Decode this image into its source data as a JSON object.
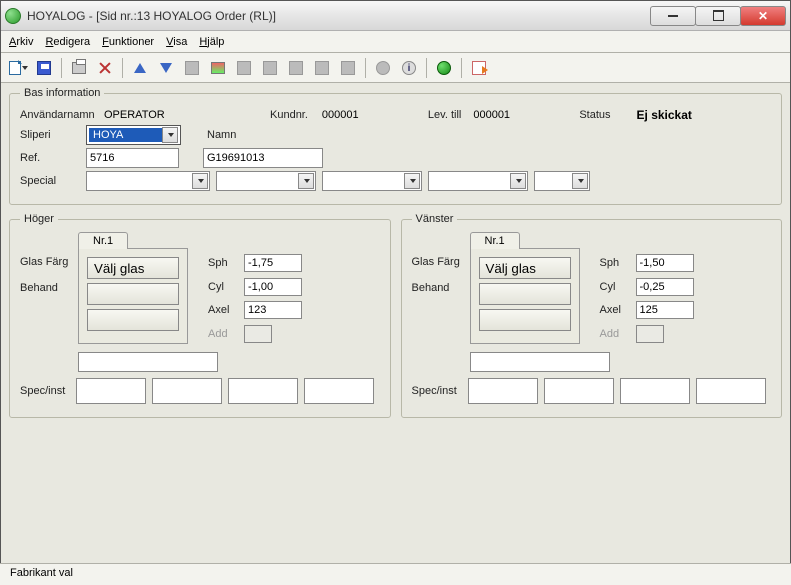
{
  "title": "HOYALOG - [Sid nr.:13 HOYALOG Order (RL)]",
  "menus": {
    "arkiv": "Arkiv",
    "redigera": "Redigera",
    "funktioner": "Funktioner",
    "visa": "Visa",
    "hjalp": "Hjälp"
  },
  "bas": {
    "legend": "Bas information",
    "anvandarnamn_lbl": "Användarnamn",
    "anvandarnamn": "OPERATOR",
    "kundnr_lbl": "Kundnr.",
    "kundnr": "000001",
    "levtill_lbl": "Lev. till",
    "levtill": "000001",
    "status_lbl": "Status",
    "status": "Ej skickat",
    "sliperi_lbl": "Sliperi",
    "sliperi": "HOYA",
    "ref_lbl": "Ref.",
    "ref": "5716",
    "namn_lbl": "Namn",
    "namn": "G19691013",
    "special_lbl": "Special"
  },
  "hoger": {
    "legend": "Höger",
    "tab": "Nr.1",
    "glas_lbl": "Glas",
    "glas_btn": "Välj glas",
    "farg_lbl": "Färg",
    "behand_lbl": "Behand",
    "spec_lbl": "Spec/inst",
    "sph_lbl": "Sph",
    "sph": "-1,75",
    "cyl_lbl": "Cyl",
    "cyl": "-1,00",
    "axel_lbl": "Axel",
    "axel": "123",
    "add_lbl": "Add",
    "add": ""
  },
  "vanster": {
    "legend": "Vänster",
    "tab": "Nr.1",
    "glas_lbl": "Glas",
    "glas_btn": "Välj glas",
    "farg_lbl": "Färg",
    "behand_lbl": "Behand",
    "spec_lbl": "Spec/inst",
    "sph_lbl": "Sph",
    "sph": "-1,50",
    "cyl_lbl": "Cyl",
    "cyl": "-0,25",
    "axel_lbl": "Axel",
    "axel": "125",
    "add_lbl": "Add",
    "add": ""
  },
  "statusbar": "Fabrikant val"
}
